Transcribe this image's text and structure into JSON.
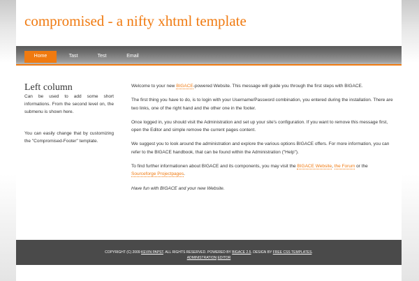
{
  "header": {
    "title": "compromised - a nifty xhtml template"
  },
  "nav": [
    {
      "label": "Home",
      "active": true
    },
    {
      "label": "Tast",
      "active": false
    },
    {
      "label": "Test",
      "active": false
    },
    {
      "label": "Email",
      "active": false
    }
  ],
  "left": {
    "title": "Left column",
    "p1": "Can be used to add some short informations. From the second level on, the submenu is shown here.",
    "p2": "You can easily change that by customizing the \"Compromised-Footer\" template."
  },
  "main": {
    "p1": {
      "a": "Welcome to your new ",
      "link": "BIGACE",
      "b": "-powered Website. This message will guide you through the first steps with BIGACE."
    },
    "p2": "The first thing you have to do, is to login with your Username/Password combination, you entered during the installation. There are two links, one of the right hand and the other one in the footer.",
    "p3": "Once logged in, you should visit the Administration and set up your site's configuration. If you want to remove this message first, open the Editor and simple remove the current pages content.",
    "p4": "We suggest you to look around the administration and explore the various options BIGACE offers. For more information, you can refer to the BIGACE handbook, that can be found within the Administration (\"Help\").",
    "p5": {
      "a": "To find further informationen about BIGACE and its components, you may visit the ",
      "link1": "BIGACE Website",
      "b": ", ",
      "link2": "the Forum",
      "c": " or the ",
      "link3": "Sourceforge Projectpages",
      "d": "."
    },
    "p6": "Have fun with BIGACE and your new Website."
  },
  "footer": {
    "copy": "COPYRIGHT (C) 2009 ",
    "author": "KEVIN PAPST",
    "rights": ". ALL RIGHTS RESERVED. POWERED BY ",
    "powered": "BIGACE 2.5",
    "design": ". DESIGN BY ",
    "designer": "FREE CSS TEMPLATES",
    "end": ".",
    "admin": "ADMINISTRATION",
    "editor": "EDITOR"
  },
  "colors": {
    "accent": "#f07a10",
    "footer_bg": "#4a4a4a",
    "text": "#333333"
  }
}
